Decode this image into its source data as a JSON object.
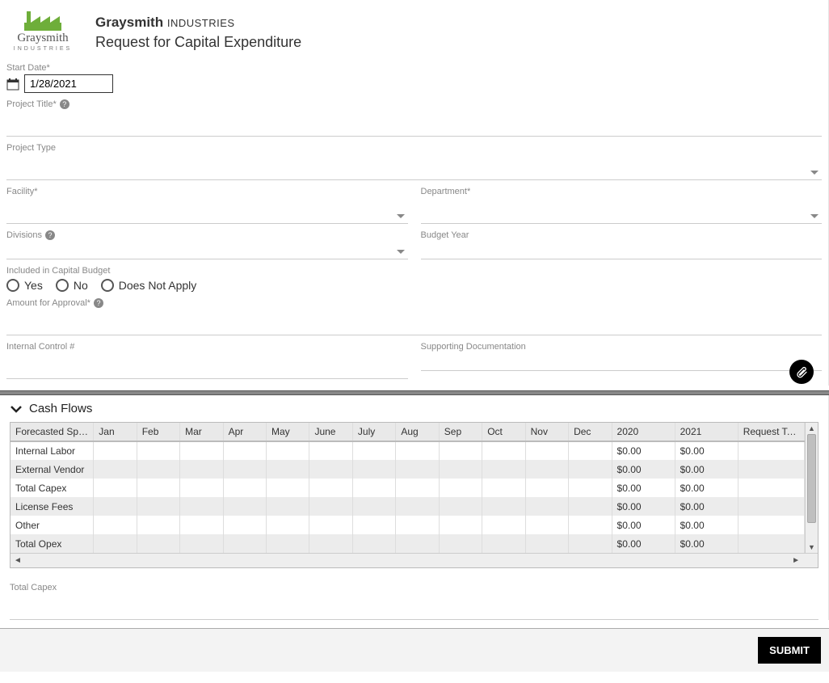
{
  "brand": {
    "name_bold": "Graysmith",
    "name_rest": "INDUSTRIES",
    "logo_text": "Graysmith",
    "logo_sub": "INDUSTRIES"
  },
  "page": {
    "title": "Request for Capital Expenditure"
  },
  "form": {
    "start_date": {
      "label": "Start Date*",
      "value": "1/28/2021"
    },
    "project_title": {
      "label": "Project Title*"
    },
    "project_type": {
      "label": "Project Type"
    },
    "facility": {
      "label": "Facility*"
    },
    "department": {
      "label": "Department*"
    },
    "divisions": {
      "label": "Divisions"
    },
    "budget_year": {
      "label": "Budget Year"
    },
    "included_in_budget": {
      "label": "Included in Capital Budget",
      "options": {
        "yes": "Yes",
        "no": "No",
        "na": "Does Not Apply"
      }
    },
    "amount_for_approval": {
      "label": "Amount for Approval*"
    },
    "internal_control": {
      "label": "Internal Control #"
    },
    "supporting_doc": {
      "label": "Supporting Documentation"
    },
    "total_capex": {
      "label": "Total Capex"
    }
  },
  "cashflows": {
    "section_title": "Cash Flows",
    "columns": {
      "label": "Forecasted Spe…",
      "months": [
        "Jan",
        "Feb",
        "Mar",
        "Apr",
        "May",
        "June",
        "July",
        "Aug",
        "Sep",
        "Oct",
        "Nov",
        "Dec"
      ],
      "year1": "2020",
      "year2": "2021",
      "request_total": "Request To…"
    },
    "rows": [
      {
        "label": "Internal Labor",
        "year1": "$0.00",
        "year2": "$0.00"
      },
      {
        "label": "External Vendor",
        "year1": "$0.00",
        "year2": "$0.00"
      },
      {
        "label": "Total Capex",
        "year1": "$0.00",
        "year2": "$0.00"
      },
      {
        "label": "License Fees",
        "year1": "$0.00",
        "year2": "$0.00"
      },
      {
        "label": "Other",
        "year1": "$0.00",
        "year2": "$0.00"
      },
      {
        "label": "Total Opex",
        "year1": "$0.00",
        "year2": "$0.00"
      }
    ]
  },
  "footer": {
    "submit": "SUBMIT"
  }
}
